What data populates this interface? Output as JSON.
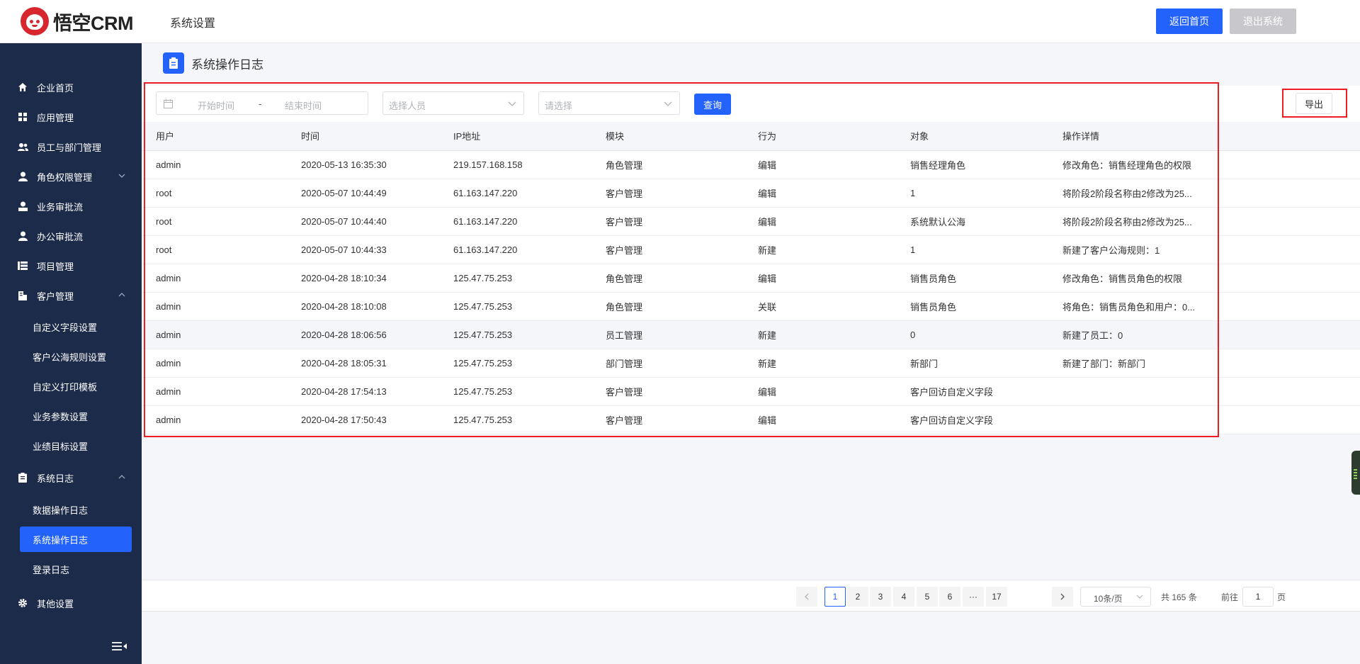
{
  "header": {
    "logo_text": "悟空CRM",
    "title": "系统设置",
    "home_button": "返回首页",
    "exit_button": "退出系统"
  },
  "sidebar": {
    "items": [
      {
        "label": "企业首页",
        "icon": "home-icon"
      },
      {
        "label": "应用管理",
        "icon": "apps-grid-icon"
      },
      {
        "label": "员工与部门管理",
        "icon": "users-icon"
      },
      {
        "label": "角色权限管理",
        "icon": "user-icon",
        "expandable": true
      },
      {
        "label": "业务审批流",
        "icon": "approval-icon"
      },
      {
        "label": "办公审批流",
        "icon": "office-user-icon"
      },
      {
        "label": "项目管理",
        "icon": "list-icon"
      },
      {
        "label": "客户管理",
        "icon": "building-icon",
        "expanded": true
      },
      {
        "label": "系统日志",
        "icon": "clipboard-icon",
        "expanded": true
      },
      {
        "label": "其他设置",
        "icon": "gear-icon"
      }
    ],
    "customer_sub": [
      "自定义字段设置",
      "客户公海规则设置",
      "自定义打印模板",
      "业务参数设置",
      "业绩目标设置"
    ],
    "log_sub": [
      "数据操作日志",
      "系统操作日志",
      "登录日志"
    ],
    "active_sub": "系统操作日志"
  },
  "page": {
    "title": "系统操作日志"
  },
  "filters": {
    "start_placeholder": "开始时间",
    "range_separator": "-",
    "end_placeholder": "结束时间",
    "user_placeholder": "选择人员",
    "module_placeholder": "请选择",
    "query_button": "查询",
    "export_button": "导出"
  },
  "table": {
    "columns": [
      "用户",
      "时间",
      "IP地址",
      "模块",
      "行为",
      "对象",
      "操作详情"
    ],
    "rows": [
      [
        "admin",
        "2020-05-13 16:35:30",
        "219.157.168.158",
        "角色管理",
        "编辑",
        "销售经理角色",
        "修改角色：销售经理角色的权限"
      ],
      [
        "root",
        "2020-05-07 10:44:49",
        "61.163.147.220",
        "客户管理",
        "编辑",
        "1",
        "将阶段2阶段名称由2修改为25..."
      ],
      [
        "root",
        "2020-05-07 10:44:40",
        "61.163.147.220",
        "客户管理",
        "编辑",
        "系统默认公海",
        "将阶段2阶段名称由2修改为25..."
      ],
      [
        "root",
        "2020-05-07 10:44:33",
        "61.163.147.220",
        "客户管理",
        "新建",
        "1",
        "新建了客户公海规则：1"
      ],
      [
        "admin",
        "2020-04-28 18:10:34",
        "125.47.75.253",
        "角色管理",
        "编辑",
        "销售员角色",
        "修改角色：销售员角色的权限"
      ],
      [
        "admin",
        "2020-04-28 18:10:08",
        "125.47.75.253",
        "角色管理",
        "关联",
        "销售员角色",
        "将角色：销售员角色和用户：0..."
      ],
      [
        "admin",
        "2020-04-28 18:06:56",
        "125.47.75.253",
        "员工管理",
        "新建",
        "0",
        "新建了员工：0"
      ],
      [
        "admin",
        "2020-04-28 18:05:31",
        "125.47.75.253",
        "部门管理",
        "新建",
        "新部门",
        "新建了部门：新部门"
      ],
      [
        "admin",
        "2020-04-28 17:54:13",
        "125.47.75.253",
        "客户管理",
        "编辑",
        "客户回访自定义字段",
        ""
      ],
      [
        "admin",
        "2020-04-28 17:50:43",
        "125.47.75.253",
        "客户管理",
        "编辑",
        "客户回访自定义字段",
        ""
      ]
    ]
  },
  "pagination": {
    "pages": [
      "1",
      "2",
      "3",
      "4",
      "5",
      "6",
      "···",
      "17"
    ],
    "current": "1",
    "page_size": "10条/页",
    "total": "共 165 条",
    "goto_label": "前往",
    "goto_value": "1",
    "goto_unit": "页"
  },
  "colors": {
    "primary": "#2362fb",
    "sidebar_bg": "#1c2b4a",
    "highlight_box": "#ee1c25"
  }
}
